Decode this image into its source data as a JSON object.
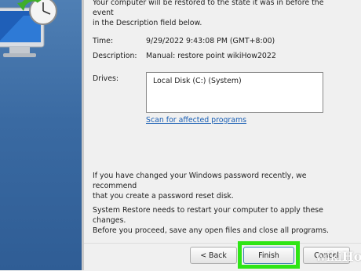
{
  "window": {
    "intro_line1": "Your computer will be restored to the state it was in before the event",
    "intro_line2": "in the Description field below."
  },
  "details": {
    "time_label": "Time:",
    "time_value": "9/29/2022 9:43:08 PM (GMT+8:00)",
    "description_label": "Description:",
    "description_value": "Manual: restore point wikiHow2022",
    "drives_label": "Drives:",
    "drives": [
      "Local Disk (C:) (System)"
    ],
    "scan_link": "Scan for affected programs"
  },
  "notes": {
    "password_line1": "If you have changed your Windows password recently, we recommend",
    "password_line2": "that you create a password reset disk.",
    "restart_line1": "System Restore needs to restart your computer to apply these changes.",
    "restart_line2": "Before you proceed, save any open files and close all programs."
  },
  "buttons": {
    "back": "< Back",
    "finish": "Finish",
    "cancel": "Cancel"
  },
  "watermark": {
    "wiki": "wiki",
    "how": "How"
  },
  "colors": {
    "highlight": "#2ee516",
    "link": "#1a5fb4",
    "side_panel": "#3a6aa2"
  },
  "icons": [
    "system-restore-monitor-clock-icon"
  ]
}
